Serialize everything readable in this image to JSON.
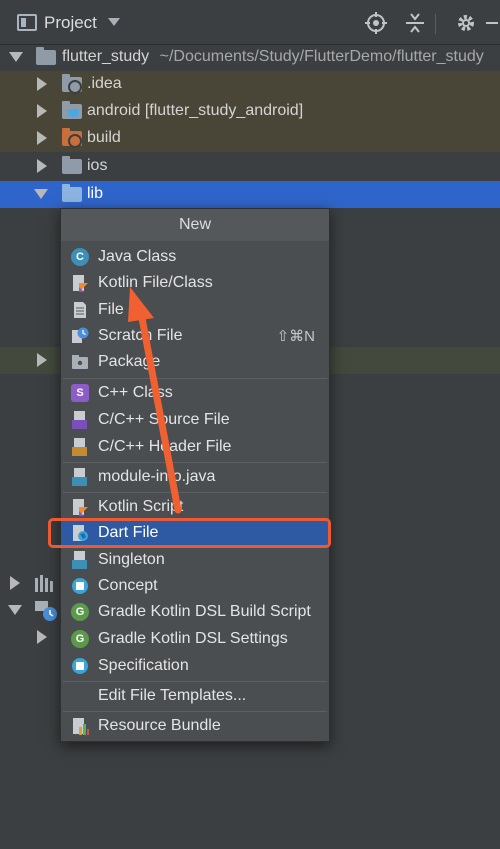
{
  "header": {
    "title": "Project"
  },
  "tree": {
    "root": {
      "name": "flutter_study",
      "path": "~/Documents/Study/FlutterDemo/flutter_study"
    },
    "idea": ".idea",
    "android": "android [flutter_study_android]",
    "build": "build",
    "ios": "ios",
    "lib": "lib"
  },
  "menu": {
    "title": "New",
    "java_class": "Java Class",
    "kotlin_class": "Kotlin File/Class",
    "file": "File",
    "scratch": "Scratch File",
    "scratch_shortcut": "⇧⌘N",
    "package": "Package",
    "cpp_class": "C++ Class",
    "cpp_source": "C/C++ Source File",
    "cpp_header": "C/C++ Header File",
    "module_info": "module-info.java",
    "kotlin_script": "Kotlin Script",
    "dart_file": "Dart File",
    "singleton": "Singleton",
    "concept": "Concept",
    "gradle_build": "Gradle Kotlin DSL Build Script",
    "gradle_settings": "Gradle Kotlin DSL Settings",
    "specification": "Specification",
    "edit_templates": "Edit File Templates...",
    "resource_bundle": "Resource Bundle"
  },
  "icon_glyphs": {
    "java": "C",
    "cpp": "S",
    "gradle_build": "G",
    "gradle_settings": "G"
  },
  "colors": {
    "selection": "#2e5aa3",
    "highlight_box": "#e95a35",
    "arrow": "#f06030"
  }
}
